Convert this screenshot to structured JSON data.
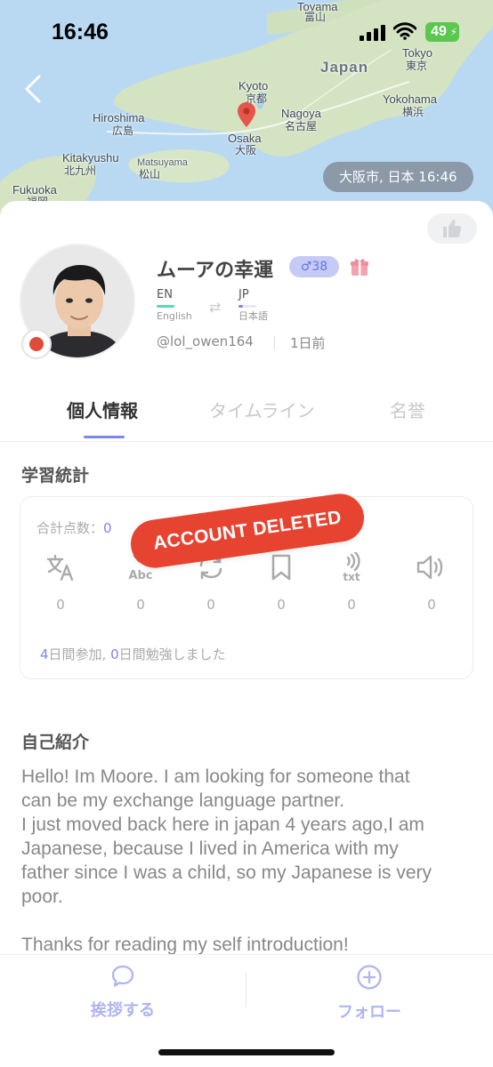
{
  "status_bar": {
    "time": "16:46",
    "battery": "49"
  },
  "map": {
    "labels": {
      "toyama_en": "Toyama",
      "toyama_jp": "富山",
      "japan": "Japan",
      "tokyo_en": "Tokyo",
      "tokyo_jp": "東京",
      "kyoto_en": "Kyoto",
      "kyoto_jp": "京都",
      "hiroshima_en": "Hiroshima",
      "hiroshima_jp": "広島",
      "nagoya_en": "Nagoya",
      "nagoya_jp": "名古屋",
      "yokohama_en": "Yokohama",
      "yokohama_jp": "横浜",
      "osaka_en": "Osaka",
      "osaka_jp": "大阪",
      "kitakyushu_en": "Kitakyushu",
      "kitakyushu_jp": "北九州",
      "matsuyama_en": "Matsuyama",
      "matsuyama_jp": "松山",
      "fukuoka_en": "Fukuoka",
      "fukuoka_jp": "福岡"
    },
    "location_chip": "大阪市, 日本 16:46"
  },
  "profile": {
    "name": "ムーアの幸運",
    "gender_badge": "♂38",
    "native_lang": {
      "code": "EN",
      "name": "English"
    },
    "learning_lang": {
      "code": "JP",
      "name": "日本語"
    },
    "handle": "@lol_owen164",
    "last_seen": "1日前",
    "colors": {
      "accent": "#7b86ec",
      "native_bar": "#5fd6b5",
      "learning_bar": "#7b86ec",
      "status_dot": "#e14b3a"
    }
  },
  "tabs": [
    {
      "label": "個人情報",
      "active": true
    },
    {
      "label": "タイムライン",
      "active": false
    },
    {
      "label": "名誉",
      "active": false
    }
  ],
  "stats": {
    "title": "学習統計",
    "total_label": "合計点数：",
    "total_value": "0",
    "items": [
      {
        "icon": "translate-icon",
        "value": "0"
      },
      {
        "icon": "abc-check-icon",
        "value": "0"
      },
      {
        "icon": "repeat-icon",
        "value": "0"
      },
      {
        "icon": "bookmark-icon",
        "value": "0"
      },
      {
        "icon": "audio-text-icon",
        "value": "0"
      },
      {
        "icon": "speaker-icon",
        "value": "0"
      }
    ],
    "joined_days": "4",
    "joined_label": "日間参加, ",
    "study_days": "0",
    "study_label": "日間勉強しました"
  },
  "account_stamp": "ACCOUNT DELETED",
  "bio": {
    "title": "自己紹介",
    "lines": [
      "Hello! Im Moore. I am looking for someone that",
      "can be my exchange language partner.",
      "I just moved back here in japan 4 years ago,I am",
      "Japanese, because I lived in America with my",
      "father since I was a child, so my Japanese is very",
      "poor.",
      "",
      "Thanks for reading my self introduction!"
    ]
  },
  "bottom_bar": {
    "greet_label": "挨拶する",
    "follow_label": "フォロー"
  }
}
